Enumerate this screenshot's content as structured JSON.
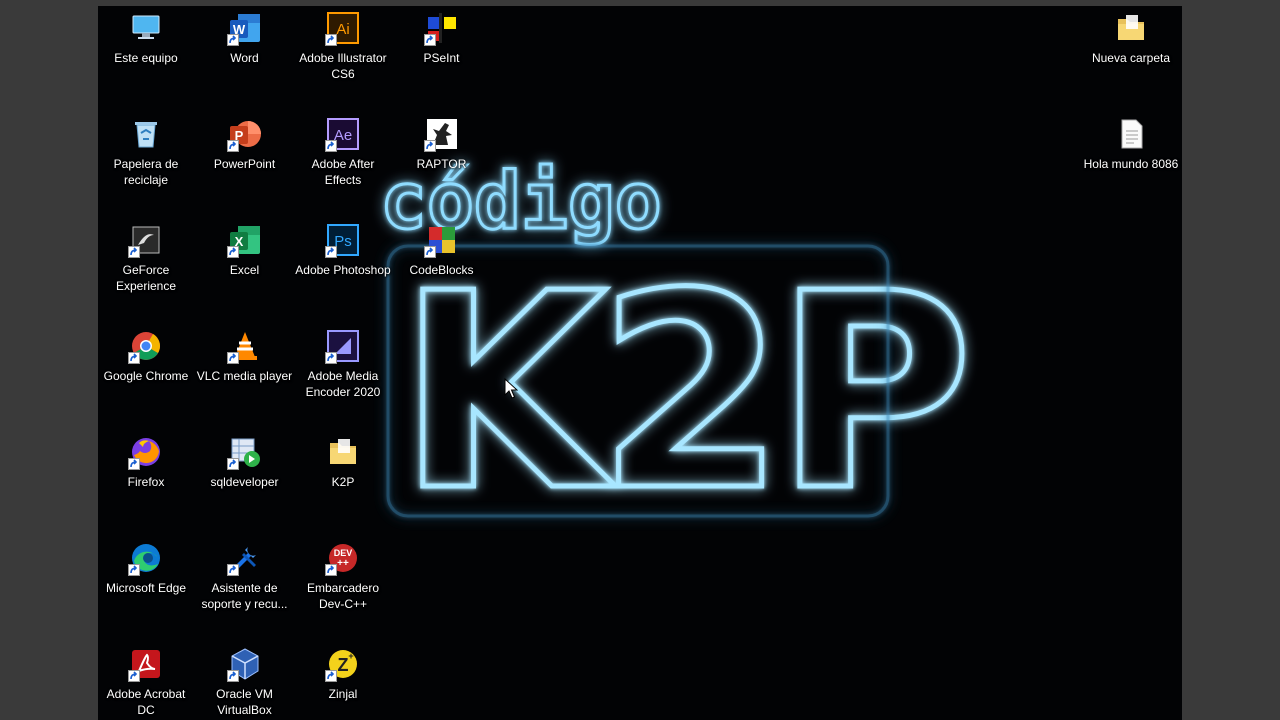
{
  "wallpaper": {
    "line1": "código",
    "line2": "K2P",
    "glow_color": "#7fd4ff"
  },
  "icons": [
    {
      "id": "este-equipo",
      "label": "Este equipo",
      "icon": "computer-icon",
      "shortcut": false
    },
    {
      "id": "word",
      "label": "Word",
      "icon": "word-icon",
      "shortcut": true
    },
    {
      "id": "illustrator",
      "label": "Adobe Illustrator CS6",
      "icon": "illustrator-icon",
      "shortcut": true
    },
    {
      "id": "pseint",
      "label": "PSeInt",
      "icon": "pseint-icon",
      "shortcut": true
    },
    {
      "id": "nueva-carpeta",
      "label": "Nueva carpeta",
      "icon": "folder-icon",
      "shortcut": false
    },
    {
      "id": "papelera",
      "label": "Papelera de reciclaje",
      "icon": "recycle-bin-icon",
      "shortcut": false
    },
    {
      "id": "powerpoint",
      "label": "PowerPoint",
      "icon": "powerpoint-icon",
      "shortcut": true
    },
    {
      "id": "after-effects",
      "label": "Adobe After Effects",
      "icon": "after-effects-icon",
      "shortcut": true
    },
    {
      "id": "raptor",
      "label": "RAPTOR",
      "icon": "raptor-icon",
      "shortcut": true
    },
    {
      "id": "hola-mundo",
      "label": "Hola mundo 8086",
      "icon": "document-icon",
      "shortcut": false
    },
    {
      "id": "geforce",
      "label": "GeForce Experience",
      "icon": "geforce-icon",
      "shortcut": true
    },
    {
      "id": "excel",
      "label": "Excel",
      "icon": "excel-icon",
      "shortcut": true
    },
    {
      "id": "photoshop",
      "label": "Adobe Photoshop",
      "icon": "photoshop-icon",
      "shortcut": true
    },
    {
      "id": "codeblocks",
      "label": "CodeBlocks",
      "icon": "codeblocks-icon",
      "shortcut": true
    },
    {
      "id": "chrome",
      "label": "Google Chrome",
      "icon": "chrome-icon",
      "shortcut": true
    },
    {
      "id": "vlc",
      "label": "VLC media player",
      "icon": "vlc-icon",
      "shortcut": true
    },
    {
      "id": "media-encoder",
      "label": "Adobe Media Encoder 2020",
      "icon": "media-encoder-icon",
      "shortcut": true
    },
    {
      "id": "firefox",
      "label": "Firefox",
      "icon": "firefox-icon",
      "shortcut": true
    },
    {
      "id": "sqldeveloper",
      "label": "sqldeveloper",
      "icon": "sqldeveloper-icon",
      "shortcut": true
    },
    {
      "id": "k2p",
      "label": "K2P",
      "icon": "folder-icon",
      "shortcut": false
    },
    {
      "id": "edge",
      "label": "Microsoft Edge",
      "icon": "edge-icon",
      "shortcut": true
    },
    {
      "id": "asistente",
      "label": "Asistente de soporte y recu...",
      "icon": "tools-icon",
      "shortcut": true
    },
    {
      "id": "devcpp",
      "label": "Embarcadero Dev-C++",
      "icon": "devcpp-icon",
      "shortcut": true
    },
    {
      "id": "acrobat",
      "label": "Adobe Acrobat DC",
      "icon": "acrobat-icon",
      "shortcut": true
    },
    {
      "id": "virtualbox",
      "label": "Oracle VM VirtualBox",
      "icon": "virtualbox-icon",
      "shortcut": true
    },
    {
      "id": "zinjal",
      "label": "Zinjal",
      "icon": "zinjal-icon",
      "shortcut": true
    }
  ]
}
